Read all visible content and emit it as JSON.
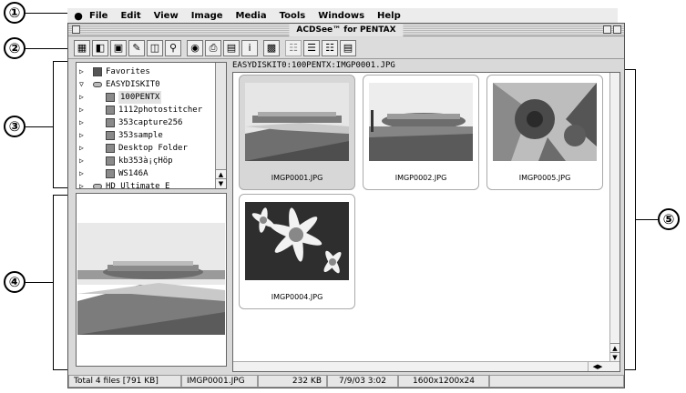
{
  "callouts": [
    "①",
    "②",
    "③",
    "④",
    "⑤"
  ],
  "menubar": {
    "apple_icon": "apple-icon",
    "items": [
      "File",
      "Edit",
      "View",
      "Image",
      "Media",
      "Tools",
      "Windows",
      "Help"
    ]
  },
  "window": {
    "title": "ACDSee™ for PENTAX"
  },
  "toolbar": {
    "buttons": [
      "browse-icon",
      "copy-icon",
      "view-icon",
      "edit-icon",
      "slideshow-icon",
      "search-icon",
      "eye-icon",
      "print-icon",
      "folder-icon",
      "info-icon",
      "properties-icon",
      "thumbnails-icon",
      "details-icon",
      "list-icon",
      "options-icon"
    ]
  },
  "tree": {
    "items": [
      {
        "label": "Favorites",
        "indent": 0,
        "icon": "favorites-icon"
      },
      {
        "label": "EASYDISKIT0",
        "indent": 0,
        "icon": "disk-icon"
      },
      {
        "label": "100PENTX",
        "indent": 1,
        "icon": "folder-icon"
      },
      {
        "label": "1112photostitcher",
        "indent": 1,
        "icon": "folder-icon"
      },
      {
        "label": "353capture256",
        "indent": 1,
        "icon": "folder-icon"
      },
      {
        "label": "353sample",
        "indent": 1,
        "icon": "folder-icon"
      },
      {
        "label": "Desktop Folder",
        "indent": 1,
        "icon": "folder-icon"
      },
      {
        "label": "kb353à¡çHöp",
        "indent": 1,
        "icon": "folder-icon"
      },
      {
        "label": "WS146A",
        "indent": 1,
        "icon": "folder-icon"
      },
      {
        "label": "HD Ultimate E",
        "indent": 0,
        "icon": "disk-icon"
      }
    ]
  },
  "path": "EASYDISKIT0:100PENTX:IMGP0001.JPG",
  "thumbnails": [
    {
      "filename": "IMGP0001.JPG",
      "scene": "stadium"
    },
    {
      "filename": "IMGP0002.JPG",
      "scene": "stadium-lawn"
    },
    {
      "filename": "IMGP0005.JPG",
      "scene": "red-flower"
    },
    {
      "filename": "IMGP0004.JPG",
      "scene": "white-daisies"
    }
  ],
  "status": {
    "total": "Total 4 files [791 KB]",
    "filename": "IMGP0001.JPG",
    "size": "232 KB",
    "date": "7/9/03 3:02",
    "dimensions": "1600x1200x24",
    "extra": ""
  }
}
